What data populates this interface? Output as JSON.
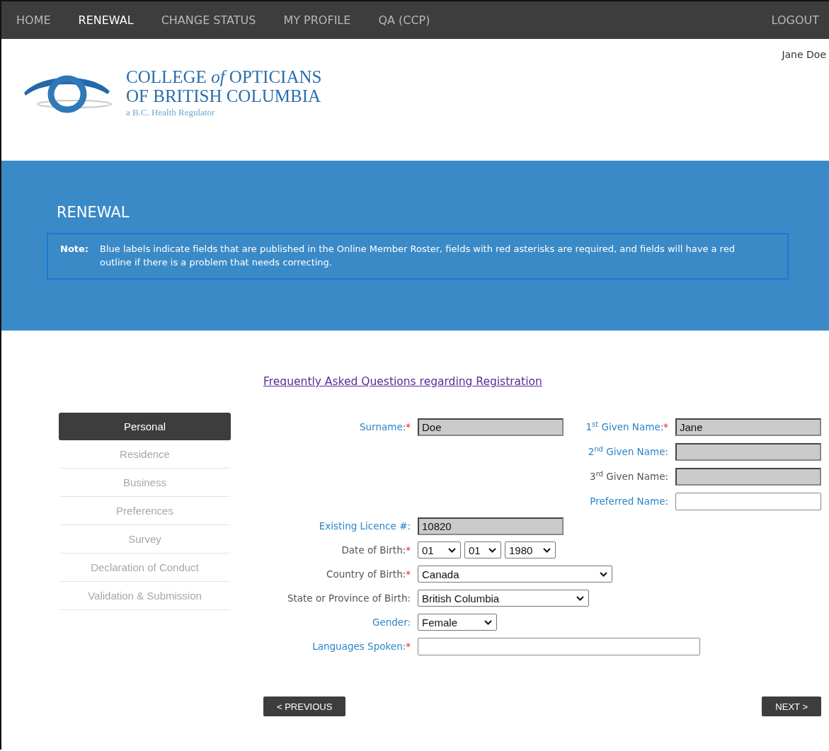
{
  "nav": {
    "items": [
      {
        "label": "HOME",
        "selected": false
      },
      {
        "label": "RENEWAL",
        "selected": true
      },
      {
        "label": "CHANGE STATUS",
        "selected": false
      },
      {
        "label": "MY PROFILE",
        "selected": false
      },
      {
        "label": "QA (CCP)",
        "selected": false
      }
    ],
    "logout": "LOGOUT"
  },
  "user_name": "Jane Doe",
  "logo": {
    "line1": "COLLEGE *of* OPTICIANS",
    "line2": "OF BRITISH COLUMBIA",
    "tagline": "a B.C. Health Regulator"
  },
  "banner": {
    "title": "RENEWAL",
    "note_label": "Note:",
    "note_text": "Blue labels indicate fields that are published in the Online Member Roster, fields with red asterisks are required, and fields will have a red outline if there is a problem that needs correcting."
  },
  "faq_link": "Frequently Asked Questions regarding Registration",
  "steps": [
    {
      "label": "Personal",
      "selected": true
    },
    {
      "label": "Residence",
      "selected": false
    },
    {
      "label": "Business",
      "selected": false
    },
    {
      "label": "Preferences",
      "selected": false
    },
    {
      "label": "Survey",
      "selected": false
    },
    {
      "label": "Declaration of Conduct",
      "selected": false
    },
    {
      "label": "Validation & Submission",
      "selected": false
    }
  ],
  "name_left": [
    {
      "label": "Surname:",
      "published": true,
      "required_mark": "*",
      "kind": "text",
      "value": "Doe",
      "readonly": true
    }
  ],
  "name_right": [
    {
      "label": "1$^{st}$ Given Name:",
      "published": true,
      "required_mark": "*",
      "kind": "text",
      "value": "Jane",
      "readonly": true
    },
    {
      "label": "2$^{nd}$ Given Name:",
      "published": true,
      "kind": "text",
      "readonly": true
    },
    {
      "label": "3$^{rd}$ Given Name:",
      "published": false,
      "kind": "text",
      "readonly": true
    },
    {
      "label": "Preferred Name:",
      "published": true,
      "kind": "text",
      "readonly": false
    }
  ],
  "fields": [
    {
      "label": "Existing Licence #:",
      "published": true,
      "kind": "text",
      "value": "10820",
      "readonly": true
    },
    {
      "label": "Date of Birth:",
      "published": false,
      "required_mark": "*",
      "kind": "date",
      "parts": [
        "01",
        "01",
        "1980"
      ]
    },
    {
      "label": "Country of Birth:",
      "published": false,
      "required_mark": "*",
      "kind": "select",
      "value": "Canada"
    },
    {
      "label": "State or Province of Birth:",
      "published": false,
      "kind": "select",
      "value": "British Columbia"
    },
    {
      "label": "Gender:",
      "published": true,
      "kind": "select",
      "value": "Female"
    },
    {
      "label": "Languages Spoken:",
      "published": true,
      "required_mark": "*",
      "kind": "text",
      "readonly": false
    }
  ],
  "buttons": {
    "previous": "< PREVIOUS",
    "next": "NEXT >"
  }
}
